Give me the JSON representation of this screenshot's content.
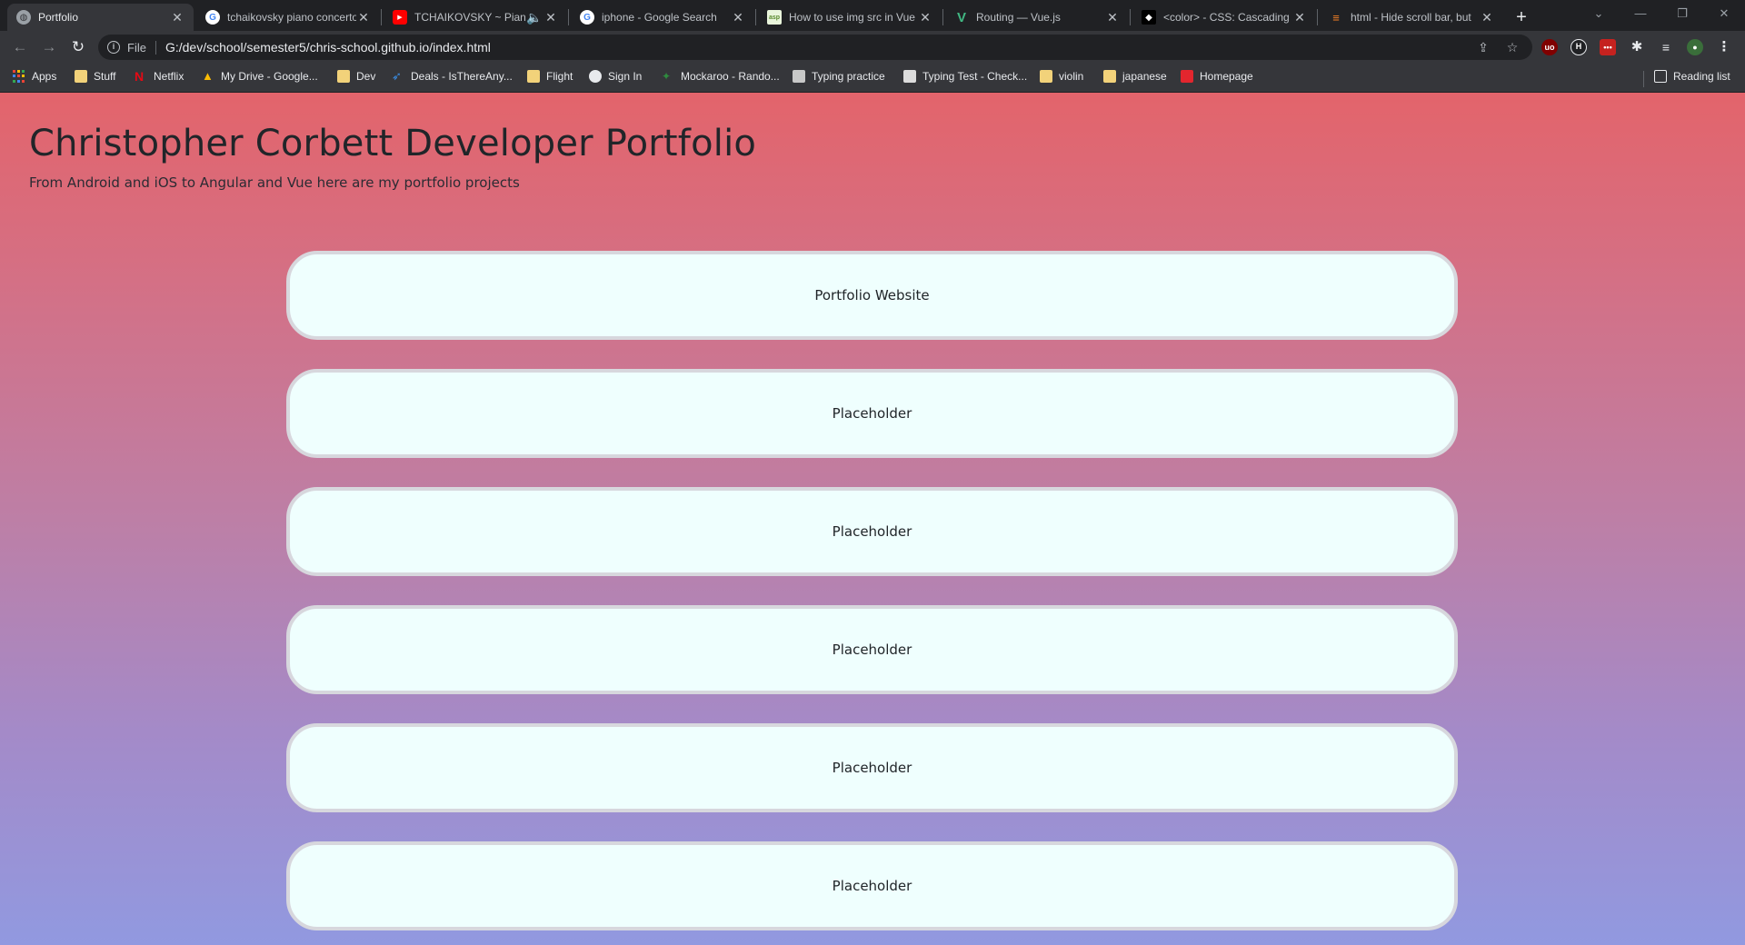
{
  "tabs": [
    {
      "title": "Portfolio",
      "icon": "globe-icon",
      "active": true
    },
    {
      "title": "tchaikovsky piano concerto",
      "icon": "google-icon"
    },
    {
      "title": "TCHAIKOVSKY ~ Piano",
      "icon": "youtube-icon",
      "audio": true
    },
    {
      "title": "iphone - Google Search",
      "icon": "google-icon"
    },
    {
      "title": "How to use img src in Vue",
      "icon": "asp-icon"
    },
    {
      "title": "Routing — Vue.js",
      "icon": "vue-icon"
    },
    {
      "title": "<color> - CSS: Cascading",
      "icon": "mdn-icon"
    },
    {
      "title": "html - Hide scroll bar, but",
      "icon": "stackoverflow-icon"
    }
  ],
  "address_bar": {
    "scheme_label": "File",
    "url": "G:/dev/school/semester5/chris-school.github.io/index.html"
  },
  "bookmarks": [
    {
      "label": "Apps",
      "icon": "apps-grid-icon"
    },
    {
      "label": "Stuff",
      "icon": "folder-icon"
    },
    {
      "label": "Netflix",
      "icon": "netflix-icon"
    },
    {
      "label": "My Drive - Google...",
      "icon": "drive-icon"
    },
    {
      "label": "Dev",
      "icon": "folder-icon"
    },
    {
      "label": "Deals - IsThereAny...",
      "icon": "deals-icon"
    },
    {
      "label": "Flight",
      "icon": "folder-icon"
    },
    {
      "label": "Sign In",
      "icon": "globe-icon"
    },
    {
      "label": "Mockaroo - Rando...",
      "icon": "mockaroo-icon"
    },
    {
      "label": "Typing practice",
      "icon": "typing-icon"
    },
    {
      "label": "Typing Test - Check...",
      "icon": "typing-test-icon"
    },
    {
      "label": "violin",
      "icon": "folder-icon"
    },
    {
      "label": "japanese",
      "icon": "folder-icon"
    },
    {
      "label": "Homepage",
      "icon": "homepage-icon"
    }
  ],
  "reading_list": "Reading list",
  "page": {
    "title": "Christopher Corbett Developer Portfolio",
    "subtitle": "From Android and iOS to Angular and Vue here are my portfolio projects",
    "projects": [
      "Portfolio Website",
      "Placeholder",
      "Placeholder",
      "Placeholder",
      "Placeholder",
      "Placeholder"
    ]
  }
}
